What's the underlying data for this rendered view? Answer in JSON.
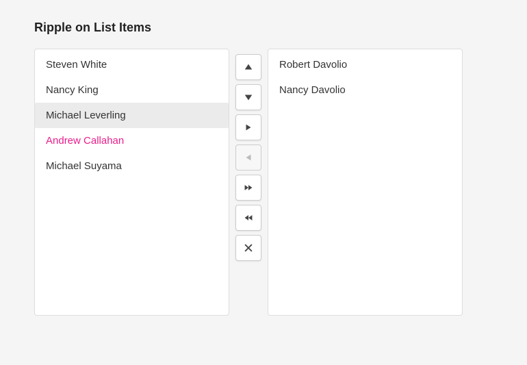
{
  "title": "Ripple on List Items",
  "left_list": {
    "items": [
      {
        "id": "steven-white",
        "label": "Steven White",
        "state": "normal"
      },
      {
        "id": "nancy-king",
        "label": "Nancy King",
        "state": "normal"
      },
      {
        "id": "michael-leverling",
        "label": "Michael Leverling",
        "state": "highlighted"
      },
      {
        "id": "andrew-callahan",
        "label": "Andrew Callahan",
        "state": "accent"
      },
      {
        "id": "michael-suyama",
        "label": "Michael Suyama",
        "state": "normal"
      }
    ]
  },
  "controls": [
    {
      "id": "move-up",
      "icon": "up",
      "label": "Move Up",
      "disabled": false
    },
    {
      "id": "move-down",
      "icon": "down",
      "label": "Move Down",
      "disabled": false
    },
    {
      "id": "move-right",
      "icon": "right",
      "label": "Move Right",
      "disabled": false
    },
    {
      "id": "move-left",
      "icon": "left",
      "label": "Move Left",
      "disabled": true
    },
    {
      "id": "move-all-right",
      "icon": "all-right",
      "label": "Move All Right",
      "disabled": false
    },
    {
      "id": "move-all-left",
      "icon": "all-left",
      "label": "Move All Left",
      "disabled": false
    },
    {
      "id": "remove",
      "icon": "remove",
      "label": "Remove",
      "disabled": false
    }
  ],
  "right_list": {
    "items": [
      {
        "id": "robert-davolio",
        "label": "Robert Davolio",
        "state": "normal"
      },
      {
        "id": "nancy-davolio",
        "label": "Nancy Davolio",
        "state": "normal"
      }
    ]
  }
}
